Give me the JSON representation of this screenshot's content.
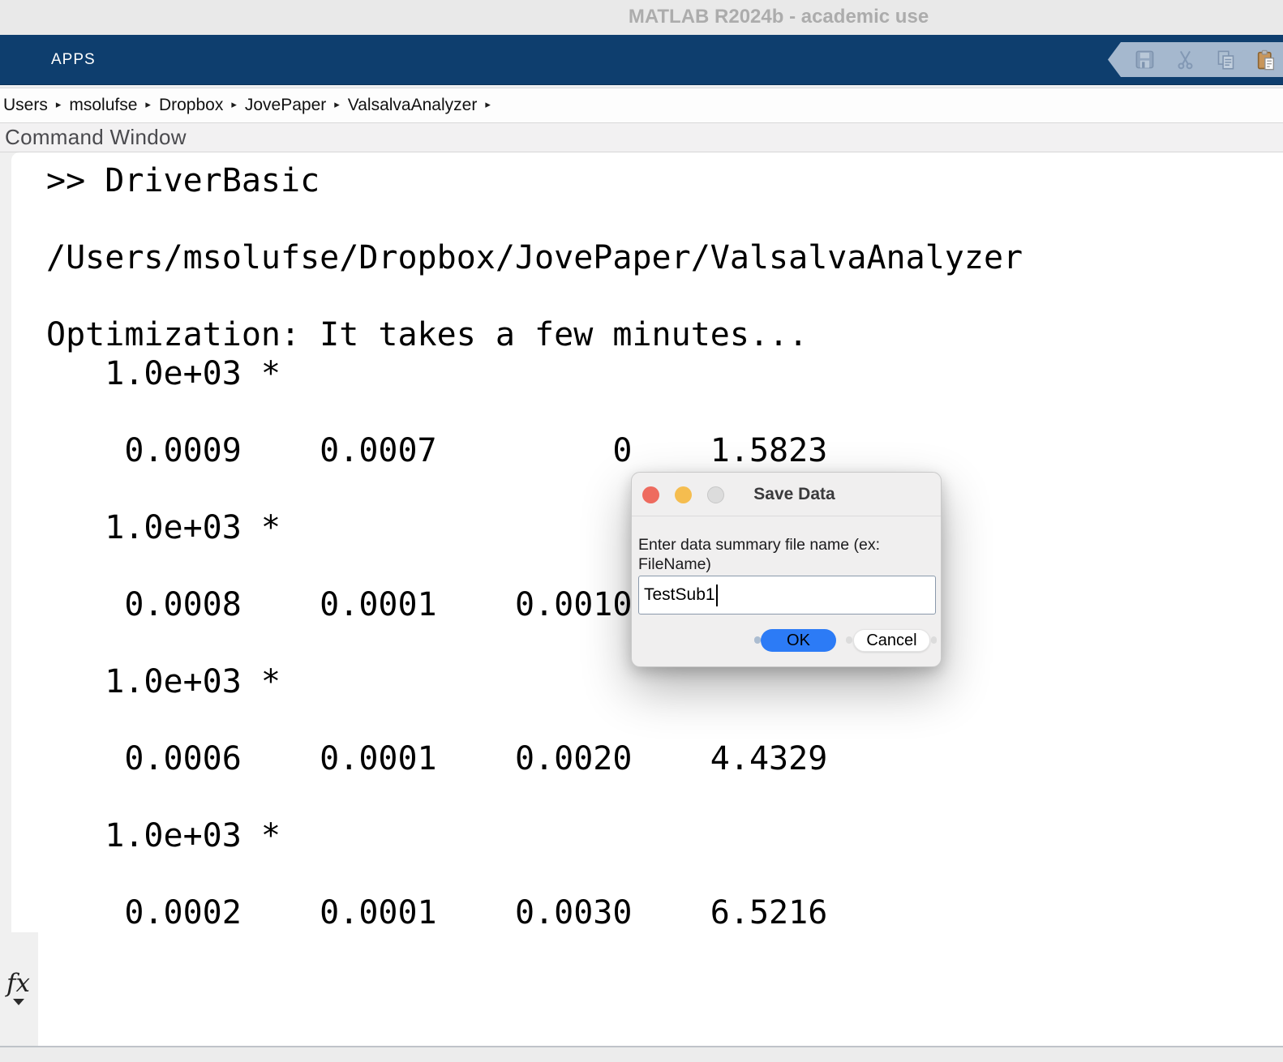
{
  "window": {
    "title": "MATLAB R2024b - academic use"
  },
  "ribbon": {
    "apps_tab": "APPS",
    "quick_access_icons": [
      "save-icon",
      "cut-icon",
      "copy-icon",
      "paste-icon"
    ]
  },
  "breadcrumb": {
    "items": [
      "Users",
      "msolufse",
      "Dropbox",
      "JovePaper",
      "ValsalvaAnalyzer"
    ],
    "separator": "▸"
  },
  "panel": {
    "title": "Command Window"
  },
  "console": {
    "fx_label": "fx",
    "lines": [
      ">> DriverBasic",
      "",
      "/Users/msolufse/Dropbox/JovePaper/ValsalvaAnalyzer",
      "",
      "Optimization: It takes a few minutes...",
      "   1.0e+03 *",
      "",
      "    0.0009    0.0007         0    1.5823",
      "",
      "   1.0e+03 *",
      "",
      "    0.0008    0.0001    0.0010",
      "",
      "   1.0e+03 *",
      "",
      "    0.0006    0.0001    0.0020    4.4329",
      "",
      "   1.0e+03 *",
      "",
      "    0.0002    0.0001    0.0030    6.5216"
    ]
  },
  "dialog": {
    "title": "Save Data",
    "prompt_line1": "Enter data summary file name (ex:",
    "prompt_line2": "FileName)",
    "filename_value": "TestSub1",
    "ok_label": "OK",
    "cancel_label": "Cancel"
  },
  "colors": {
    "ribbon_navy": "#0E3E6E",
    "quick_access_pill": "#A5B8CE",
    "accent_blue": "#2C7BF6",
    "traffic_red": "#EE6B5F",
    "traffic_yellow": "#F5BD4F",
    "traffic_gray": "#DCDCDC",
    "paste_clipboard_tan": "#C8965A"
  }
}
